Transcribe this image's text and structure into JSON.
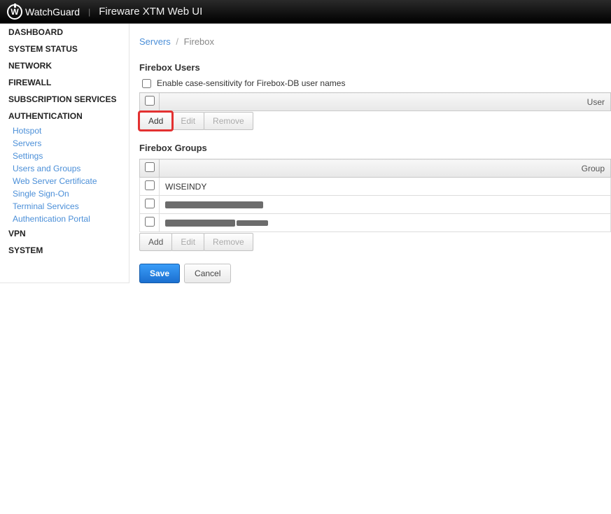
{
  "header": {
    "brand": "WatchGuard",
    "app_title": "Fireware XTM Web UI"
  },
  "sidebar": {
    "sections": [
      {
        "label": "DASHBOARD"
      },
      {
        "label": "SYSTEM STATUS"
      },
      {
        "label": "NETWORK"
      },
      {
        "label": "FIREWALL"
      },
      {
        "label": "SUBSCRIPTION SERVICES"
      },
      {
        "label": "AUTHENTICATION",
        "children": [
          {
            "label": "Hotspot"
          },
          {
            "label": "Servers"
          },
          {
            "label": "Settings"
          },
          {
            "label": "Users and Groups"
          },
          {
            "label": "Web Server Certificate"
          },
          {
            "label": "Single Sign-On"
          },
          {
            "label": "Terminal Services"
          },
          {
            "label": "Authentication Portal"
          }
        ]
      },
      {
        "label": "VPN"
      },
      {
        "label": "SYSTEM"
      }
    ]
  },
  "breadcrumb": {
    "parent": "Servers",
    "current": "Firebox"
  },
  "users": {
    "title": "Firebox Users",
    "checkbox_label": "Enable case-sensitivity for Firebox-DB user names",
    "col_header": "User",
    "buttons": {
      "add": "Add",
      "edit": "Edit",
      "remove": "Remove"
    }
  },
  "groups": {
    "title": "Firebox Groups",
    "col_header": "Group",
    "rows": [
      {
        "text": "WISEINDY",
        "redacted": false
      },
      {
        "text": "",
        "redacted": true
      },
      {
        "text": "",
        "redacted": true
      }
    ],
    "buttons": {
      "add": "Add",
      "edit": "Edit",
      "remove": "Remove"
    }
  },
  "actions": {
    "save": "Save",
    "cancel": "Cancel"
  }
}
